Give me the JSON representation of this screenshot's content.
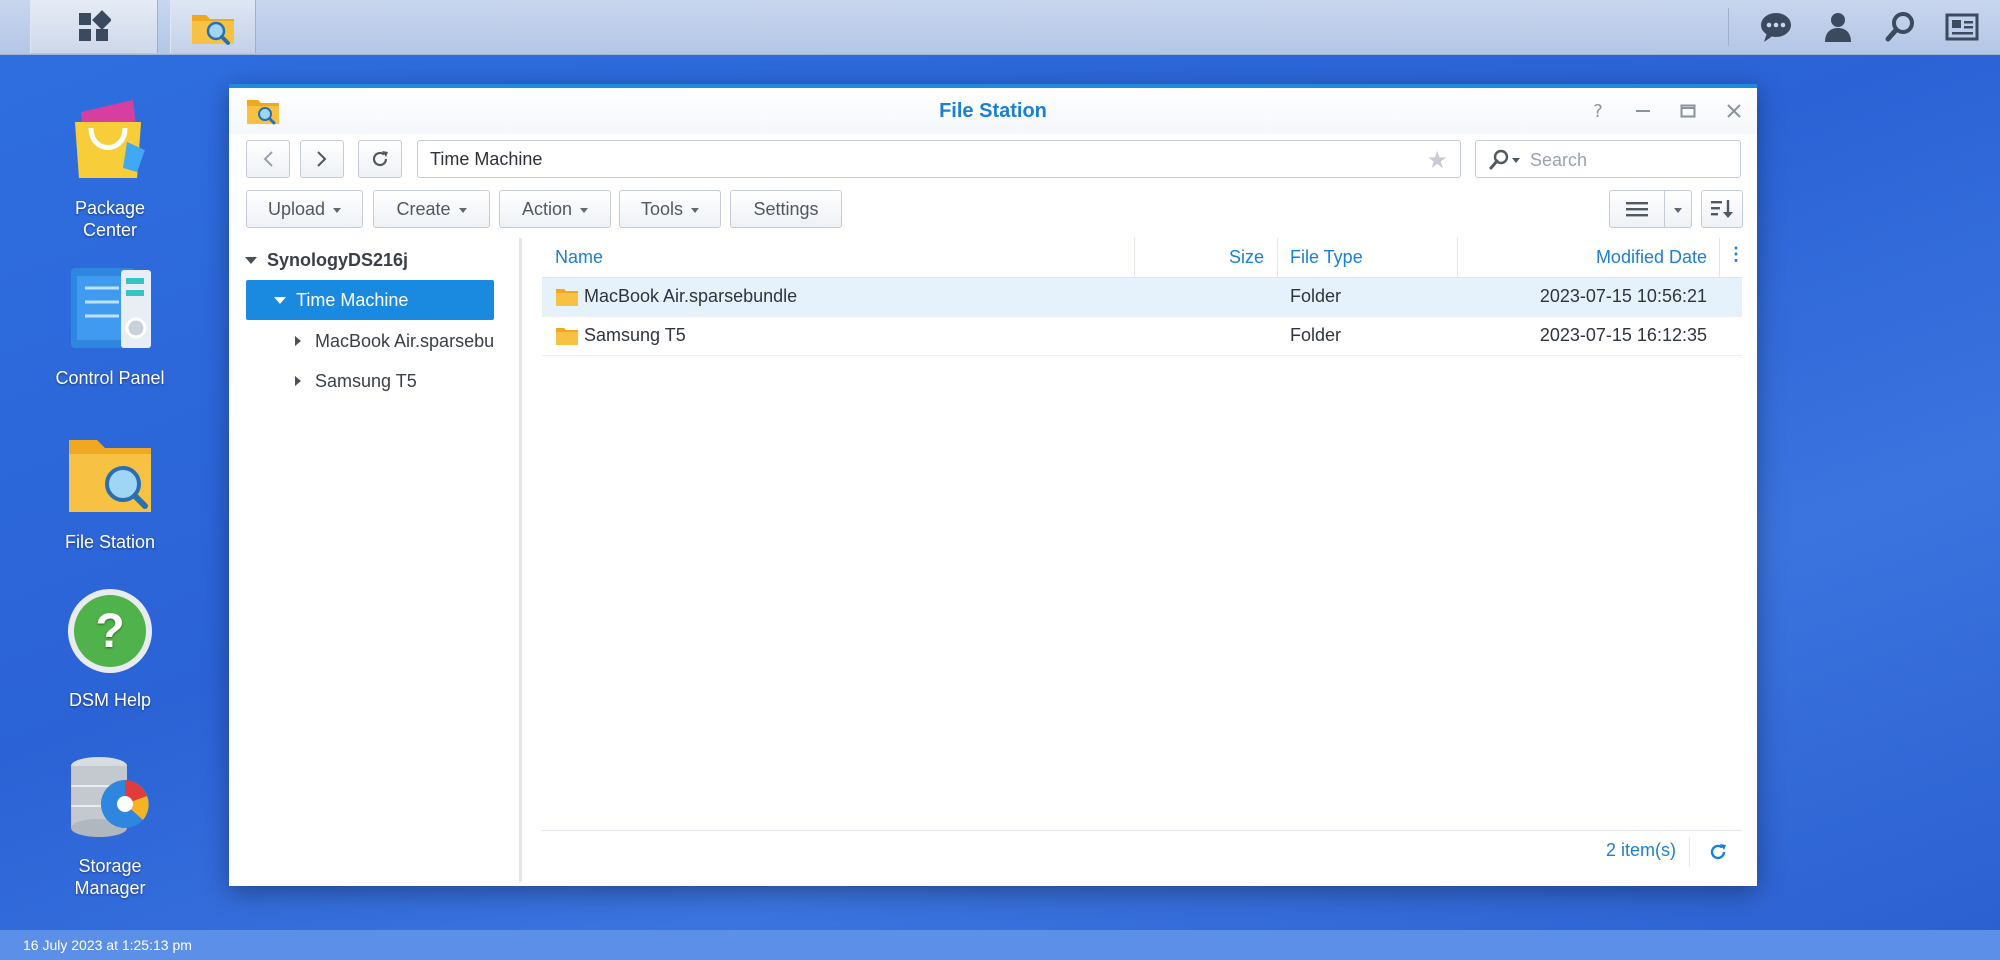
{
  "desktop": {
    "icons": [
      {
        "label": "Package\nCenter"
      },
      {
        "label": "Control Panel"
      },
      {
        "label": "File Station"
      },
      {
        "label": "DSM Help"
      },
      {
        "label": "Storage\nManager"
      }
    ],
    "clock": "16 July 2023 at 1:25:13 pm"
  },
  "window": {
    "title": "File Station",
    "path": "Time Machine",
    "search_placeholder": "Search",
    "toolbar": {
      "upload": "Upload",
      "create": "Create",
      "action": "Action",
      "tools": "Tools",
      "settings": "Settings"
    },
    "tree": {
      "root": "SynologyDS216j",
      "selected": "Time Machine",
      "children": [
        "MacBook Air.sparsebundle",
        "Samsung T5"
      ]
    },
    "list": {
      "columns": [
        "Name",
        "Size",
        "File Type",
        "Modified Date"
      ],
      "rows": [
        {
          "name": "MacBook Air.sparsebundle",
          "size": "",
          "type": "Folder",
          "modified": "2023-07-15 10:56:21"
        },
        {
          "name": "Samsung T5",
          "size": "",
          "type": "Folder",
          "modified": "2023-07-15 16:12:35"
        }
      ]
    },
    "status": "2 item(s)"
  },
  "colors": {
    "accent": "#1a80d2",
    "selection": "#1a8ae0",
    "folder": "#f5b323"
  }
}
